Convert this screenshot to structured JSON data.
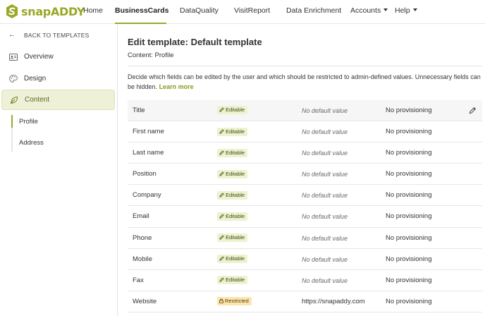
{
  "brand": {
    "name": "snapADDY",
    "accent": "#9aa825"
  },
  "nav": {
    "items": [
      {
        "label": "Home"
      },
      {
        "label": "BusinessCards",
        "active": true
      },
      {
        "label": "DataQuality"
      },
      {
        "label": "VisitReport"
      },
      {
        "label": "Data Enrichment"
      },
      {
        "label": "Accounts",
        "dropdown": true
      },
      {
        "label": "Help",
        "dropdown": true
      }
    ]
  },
  "sidebar": {
    "back_label": "BACK TO TEMPLATES",
    "items": [
      {
        "label": "Overview",
        "icon": "id-card-icon"
      },
      {
        "label": "Design",
        "icon": "palette-icon"
      },
      {
        "label": "Content",
        "icon": "leaf-icon",
        "active": true
      }
    ],
    "sub_items": [
      {
        "label": "Profile",
        "active": true
      },
      {
        "label": "Address"
      }
    ]
  },
  "main": {
    "title": "Edit template: Default template",
    "subtitle": "Content: Profile",
    "description": "Decide which fields can be edited by the user and which should be restricted to admin-defined values. Unnecessary fields can be hidden.",
    "learn_more": "Learn more"
  },
  "fields": [
    {
      "name": "Title",
      "status": "Editable",
      "default": "No default value",
      "provisioning": "No provisioning"
    },
    {
      "name": "First name",
      "status": "Editable",
      "default": "No default value",
      "provisioning": "No provisioning"
    },
    {
      "name": "Last name",
      "status": "Editable",
      "default": "No default value",
      "provisioning": "No provisioning"
    },
    {
      "name": "Position",
      "status": "Editable",
      "default": "No default value",
      "provisioning": "No provisioning"
    },
    {
      "name": "Company",
      "status": "Editable",
      "default": "No default value",
      "provisioning": "No provisioning"
    },
    {
      "name": "Email",
      "status": "Editable",
      "default": "No default value",
      "provisioning": "No provisioning"
    },
    {
      "name": "Phone",
      "status": "Editable",
      "default": "No default value",
      "provisioning": "No provisioning"
    },
    {
      "name": "Mobile",
      "status": "Editable",
      "default": "No default value",
      "provisioning": "No provisioning"
    },
    {
      "name": "Fax",
      "status": "Editable",
      "default": "No default value",
      "provisioning": "No provisioning"
    },
    {
      "name": "Website",
      "status": "Restricted",
      "default": "https://snapaddy.com",
      "provisioning": "No provisioning"
    }
  ]
}
